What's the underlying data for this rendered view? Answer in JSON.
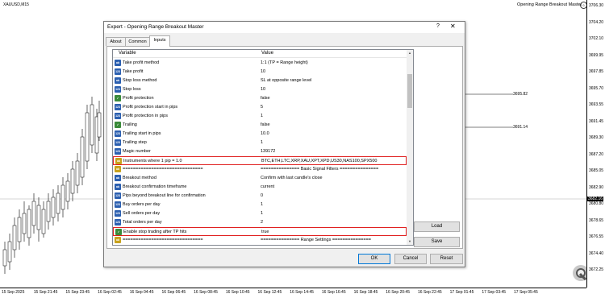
{
  "chart": {
    "symbol_label": "XAUUSD,M15",
    "ea_label": "Opening Range Breakout Master",
    "price_ticks": [
      "3706.30",
      "3704.20",
      "3702.10",
      "3699.95",
      "3697.85",
      "3695.70",
      "3693.55",
      "3691.45",
      "3689.30",
      "3687.20",
      "3685.05",
      "3682.90",
      "3680.80",
      "3678.65",
      "3676.55",
      "3674.40",
      "3672.25"
    ],
    "current_price": "3682.16",
    "line_labels": [
      "3695.82",
      "3691.14"
    ],
    "time_ticks": [
      "15 Sep 2025",
      "15 Sep 21:45",
      "15 Sep 23:45",
      "16 Sep 02:45",
      "16 Sep 04:45",
      "16 Sep 06:45",
      "16 Sep 08:45",
      "16 Sep 10:45",
      "16 Sep 12:45",
      "16 Sep 14:45",
      "16 Sep 16:45",
      "16 Sep 18:45",
      "16 Sep 20:45",
      "16 Sep 22:45",
      "17 Sep 01:45",
      "17 Sep 03:45",
      "17 Sep 05:45"
    ],
    "smiley_icon": "smiley-icon",
    "zoom_icon": "magnifier-icon"
  },
  "dialog": {
    "title": "Expert - Opening Range Breakout Master",
    "help": "?",
    "close": "✕",
    "tabs": [
      "About",
      "Common",
      "Inputs"
    ],
    "active_tab": "Inputs",
    "columns": [
      "Variable",
      "Value"
    ],
    "rows": [
      {
        "name": "Take profit method",
        "value": "1:1 (TP = Range height)",
        "icon": "enum",
        "hl": false
      },
      {
        "name": "Take profit",
        "value": "10",
        "icon": "num",
        "hl": false
      },
      {
        "name": "Stop loss method",
        "value": "SL at opposite range level",
        "icon": "enum",
        "hl": false
      },
      {
        "name": "Stop loss",
        "value": "10",
        "icon": "num",
        "hl": false
      },
      {
        "name": "Profit protection",
        "value": "false",
        "icon": "bool",
        "hl": false
      },
      {
        "name": "Profit protection start in pips",
        "value": "5",
        "icon": "num",
        "hl": false
      },
      {
        "name": "Profit protection in pips",
        "value": "1",
        "icon": "num",
        "hl": false
      },
      {
        "name": "Trailing",
        "value": "false",
        "icon": "bool",
        "hl": false
      },
      {
        "name": "Trailing start in pips",
        "value": "10.0",
        "icon": "num",
        "hl": false
      },
      {
        "name": "Trailing step",
        "value": "1",
        "icon": "num",
        "hl": false
      },
      {
        "name": "Magic number",
        "value": "139172",
        "icon": "num",
        "hl": false
      },
      {
        "name": "Instruments where 1 pip = 1.0",
        "value": "BTC,ETH,LTC,XRP,XAU,XPT,XPD,US30,NAS100,SPX500",
        "icon": "str",
        "hl": true
      },
      {
        "name": "===============================",
        "value": "=============== Basic Signal Filters ===============",
        "icon": "str",
        "hl": false
      },
      {
        "name": "Breakout method",
        "value": "Confirm with last candle's close",
        "icon": "enum",
        "hl": false
      },
      {
        "name": "Breakout confirmation timeframe",
        "value": "current",
        "icon": "enum",
        "hl": false
      },
      {
        "name": "Pips beyond breakout line for confirmation",
        "value": "0",
        "icon": "num",
        "hl": false
      },
      {
        "name": "Buy orders per day",
        "value": "1",
        "icon": "num",
        "hl": false
      },
      {
        "name": "Sell orders per day",
        "value": "1",
        "icon": "num",
        "hl": false
      },
      {
        "name": "Total orders per day",
        "value": "2",
        "icon": "num",
        "hl": false
      },
      {
        "name": "Enable stop trading after TP hits",
        "value": "true",
        "icon": "bool",
        "hl": true
      },
      {
        "name": "===============================",
        "value": "=============== Range Settings ===============",
        "icon": "str",
        "hl": false
      }
    ],
    "load_label": "Load",
    "save_label": "Save",
    "ok_label": "OK",
    "cancel_label": "Cancel",
    "reset_label": "Reset"
  }
}
